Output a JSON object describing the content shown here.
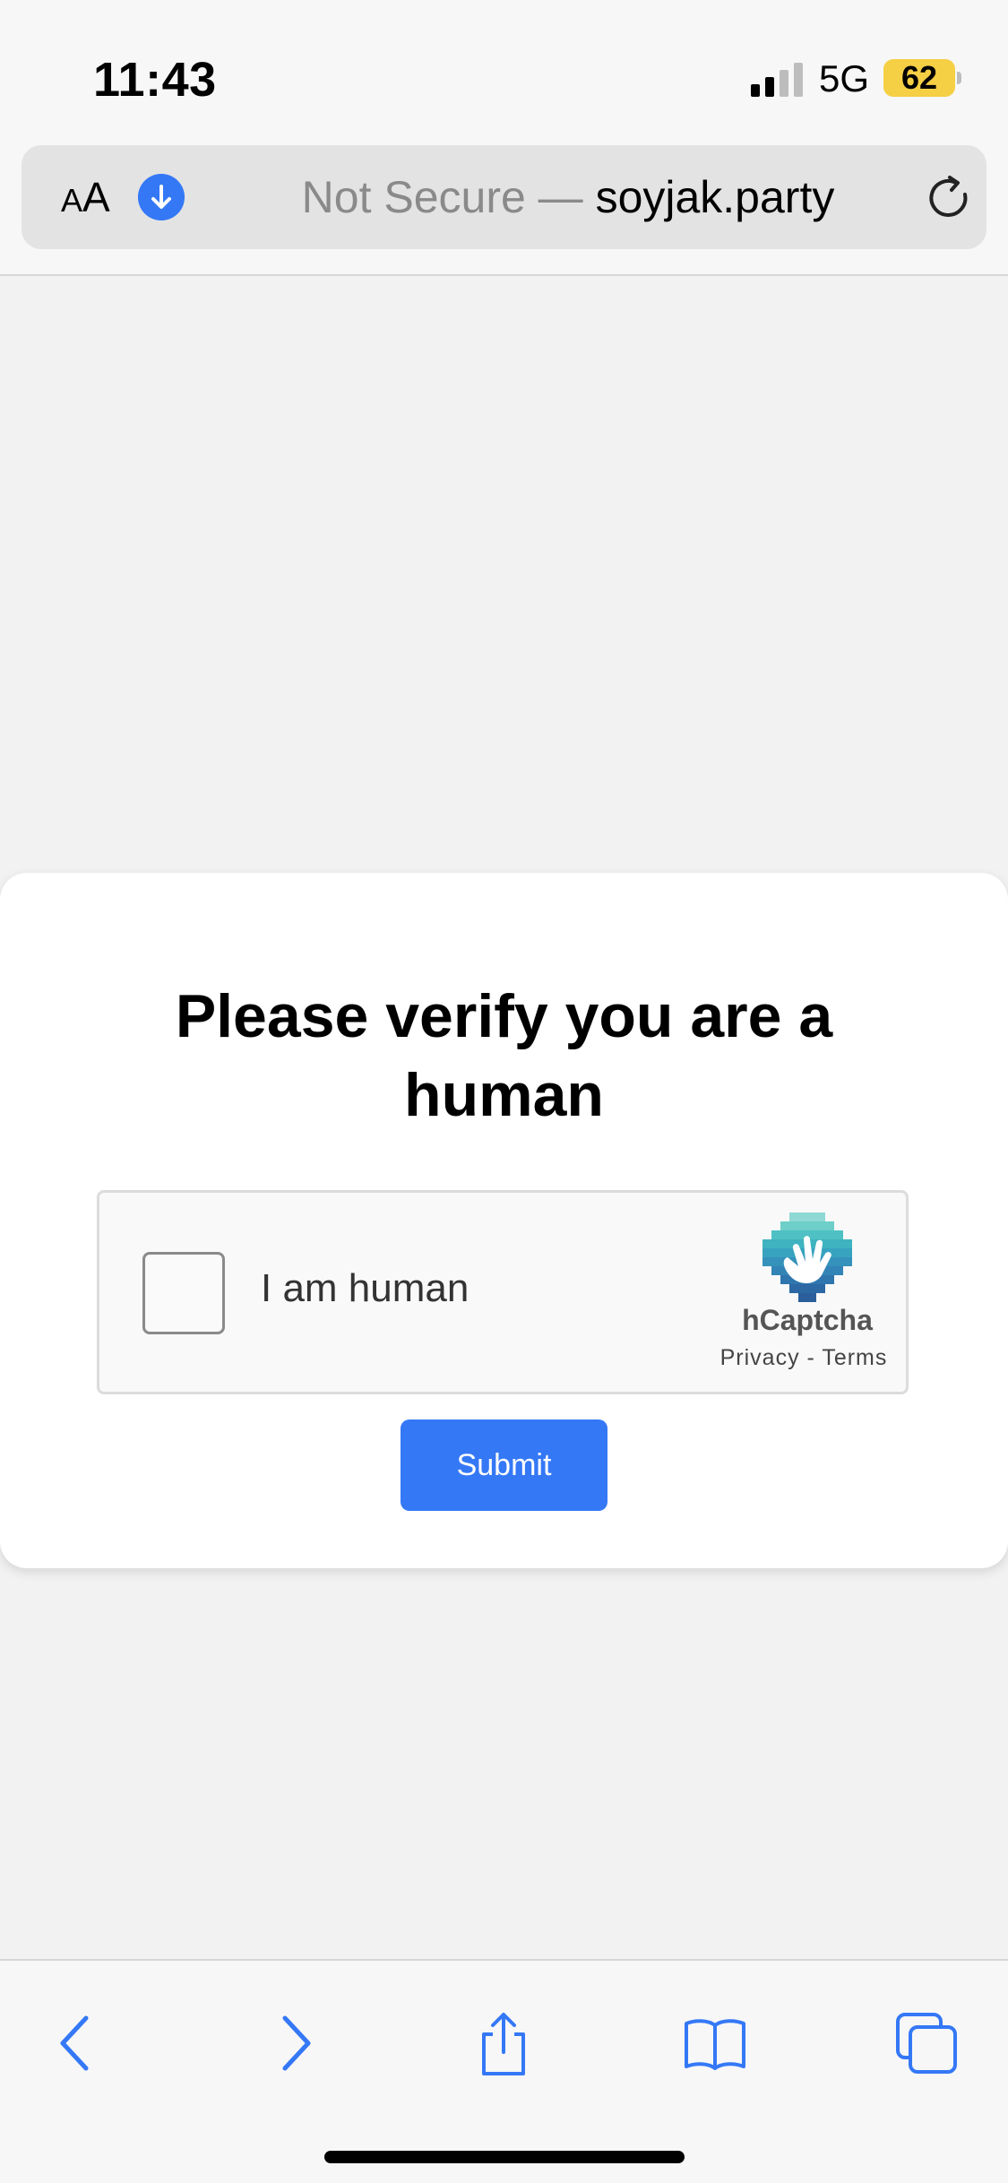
{
  "status_bar": {
    "time": "11:43",
    "network": "5G",
    "battery": "62"
  },
  "address_bar": {
    "aa_label_small": "A",
    "aa_label_large": "A",
    "url_prefix": "Not Secure — ",
    "url_domain": "soyjak.party"
  },
  "captcha_card": {
    "title": "Please verify you are a human",
    "checkbox_label": "I am human",
    "brand": "hCaptcha",
    "links": "Privacy - Terms",
    "submit_label": "Submit"
  },
  "toolbar": {
    "items": [
      "back-icon",
      "forward-icon",
      "share-icon",
      "bookmarks-icon",
      "tabs-icon"
    ]
  },
  "colors": {
    "accent": "#3478f6",
    "battery": "#f5cf44",
    "page_background": "#f2f2f2"
  }
}
